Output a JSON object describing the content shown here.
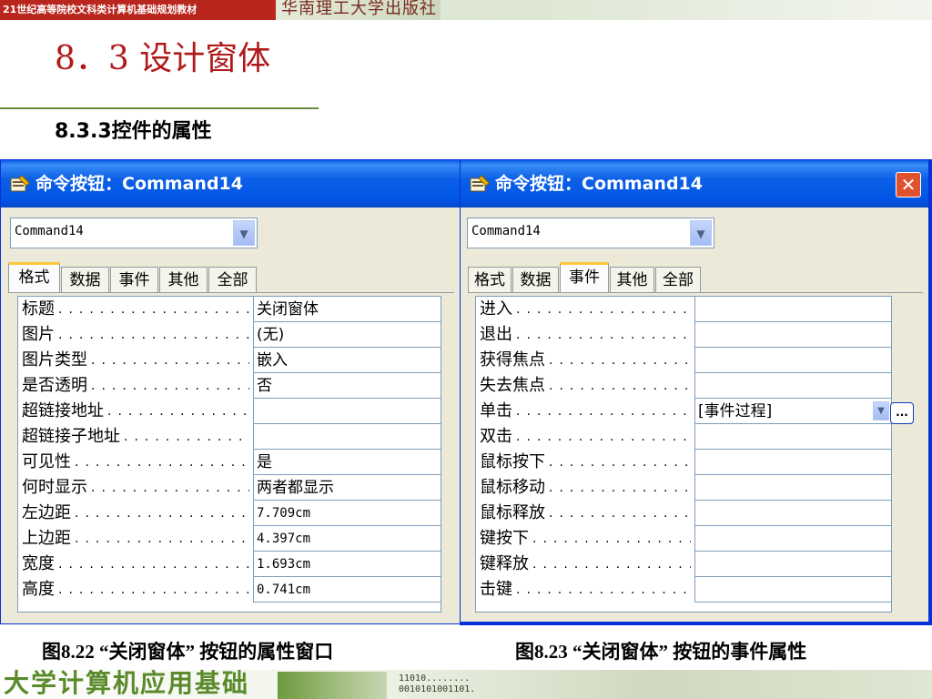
{
  "header": {
    "series": "21世纪高等院校文科类计算机基础规划教材",
    "publisher": "华南理工大学出版社"
  },
  "section_title": "8．3  设计窗体",
  "subsection_title": "8.3.3控件的属性",
  "left_window": {
    "title": "命令按钮：Command14",
    "combo_value": "Command14",
    "tabs": [
      "格式",
      "数据",
      "事件",
      "其他",
      "全部"
    ],
    "active_tab": "格式",
    "properties": [
      {
        "label": "标题",
        "value": "关闭窗体"
      },
      {
        "label": "图片",
        "value": "(无)"
      },
      {
        "label": "图片类型",
        "value": "嵌入"
      },
      {
        "label": "是否透明",
        "value": "否"
      },
      {
        "label": "超链接地址",
        "value": ""
      },
      {
        "label": "超链接子地址",
        "value": ""
      },
      {
        "label": "可见性",
        "value": "是"
      },
      {
        "label": "何时显示",
        "value": "两者都显示"
      },
      {
        "label": "左边距",
        "value": "7.709cm"
      },
      {
        "label": "上边距",
        "value": "4.397cm"
      },
      {
        "label": "宽度",
        "value": "1.693cm"
      },
      {
        "label": "高度",
        "value": "0.741cm"
      }
    ]
  },
  "right_window": {
    "title": "命令按钮：Command14",
    "close_glyph": "✕",
    "combo_value": "Command14",
    "tabs": [
      "格式",
      "数据",
      "事件",
      "其他",
      "全部"
    ],
    "active_tab": "事件",
    "events": [
      {
        "label": "进入",
        "value": ""
      },
      {
        "label": "退出",
        "value": ""
      },
      {
        "label": "获得焦点",
        "value": ""
      },
      {
        "label": "失去焦点",
        "value": ""
      },
      {
        "label": "单击",
        "value": "[事件过程]"
      },
      {
        "label": "双击",
        "value": ""
      },
      {
        "label": "鼠标按下",
        "value": ""
      },
      {
        "label": "鼠标移动",
        "value": ""
      },
      {
        "label": "鼠标释放",
        "value": ""
      },
      {
        "label": "键按下",
        "value": ""
      },
      {
        "label": "键释放",
        "value": ""
      },
      {
        "label": "击键",
        "value": ""
      }
    ],
    "builder_glyph": "..."
  },
  "captions": {
    "left": "图8.22 “关闭窗体” 按钮的属性窗口",
    "right": "图8.23 “关闭窗体” 按钮的事件属性"
  },
  "footer": {
    "title": "大学计算机应用基础",
    "binary_line1": "11010........",
    "binary_line2": "0010101001101."
  },
  "icons": {
    "window_icon": "properties-sheet-icon",
    "dropdown": "chevron-down-icon",
    "close": "close-icon",
    "builder": "ellipsis-icon"
  }
}
